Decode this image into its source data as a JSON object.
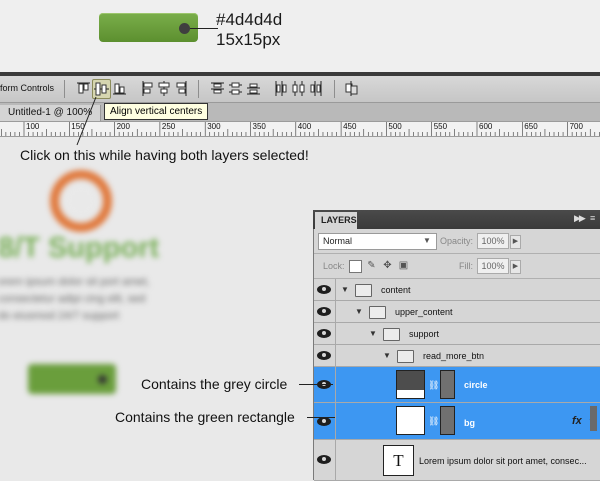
{
  "top_notes": {
    "hex": "#4d4d4d",
    "size": "15x15px"
  },
  "options_bar": {
    "transform_label": "form Controls",
    "tooltip": "Align vertical centers",
    "icons": [
      "align-top-edges-icon",
      "align-vertical-centers-icon",
      "align-bottom-edges-icon",
      "align-left-edges-icon",
      "align-horizontal-centers-icon",
      "align-right-edges-icon",
      "distribute-top-icon",
      "distribute-vertical-centers-icon",
      "distribute-bottom-icon",
      "distribute-left-icon",
      "distribute-horizontal-centers-icon",
      "distribute-right-icon",
      "auto-align-layers-icon"
    ]
  },
  "document": {
    "tab_label": "Untitled-1 @ 100%",
    "ruler_labels": [
      "100",
      "150",
      "200",
      "250",
      "300",
      "350",
      "400",
      "450",
      "500",
      "550",
      "600",
      "650",
      "700"
    ]
  },
  "annotations": {
    "click_note": "Click on this while having both layers selected!",
    "grey_circle": "Contains the grey circle",
    "green_rectangle": "Contains the green rectangle"
  },
  "canvas_preview": {
    "heading": "8/T Support",
    "text": "orem ipsum dolor sit port amet, consectetur adipi cing elit, sed do eiusmod 24/7 support"
  },
  "layers_panel": {
    "title": "LAYERS",
    "blend_mode": "Normal",
    "opacity_label": "Opacity:",
    "opacity_value": "100%",
    "lock_label": "Lock:",
    "fill_label": "Fill:",
    "fill_value": "100%",
    "layers": [
      {
        "name": "content",
        "type": "group",
        "depth": 0,
        "selected": false
      },
      {
        "name": "upper_content",
        "type": "group",
        "depth": 1,
        "selected": false
      },
      {
        "name": "support",
        "type": "group",
        "depth": 2,
        "selected": false
      },
      {
        "name": "read_more_btn",
        "type": "group",
        "depth": 3,
        "selected": false
      },
      {
        "name": "circle",
        "type": "shape",
        "depth": 4,
        "selected": true
      },
      {
        "name": "bg",
        "type": "shape",
        "depth": 4,
        "selected": true,
        "fx": "fx"
      },
      {
        "name": "Lorem ipsum dolor sit port amet, consec...",
        "type": "text",
        "depth": 4,
        "selected": false,
        "thumb": "T"
      }
    ]
  },
  "colors": {
    "selection_blue": "#3d97f2",
    "button_green": "#6a9e3c",
    "circle_grey": "#4d4d4d",
    "ring_orange": "#e07a3e"
  }
}
